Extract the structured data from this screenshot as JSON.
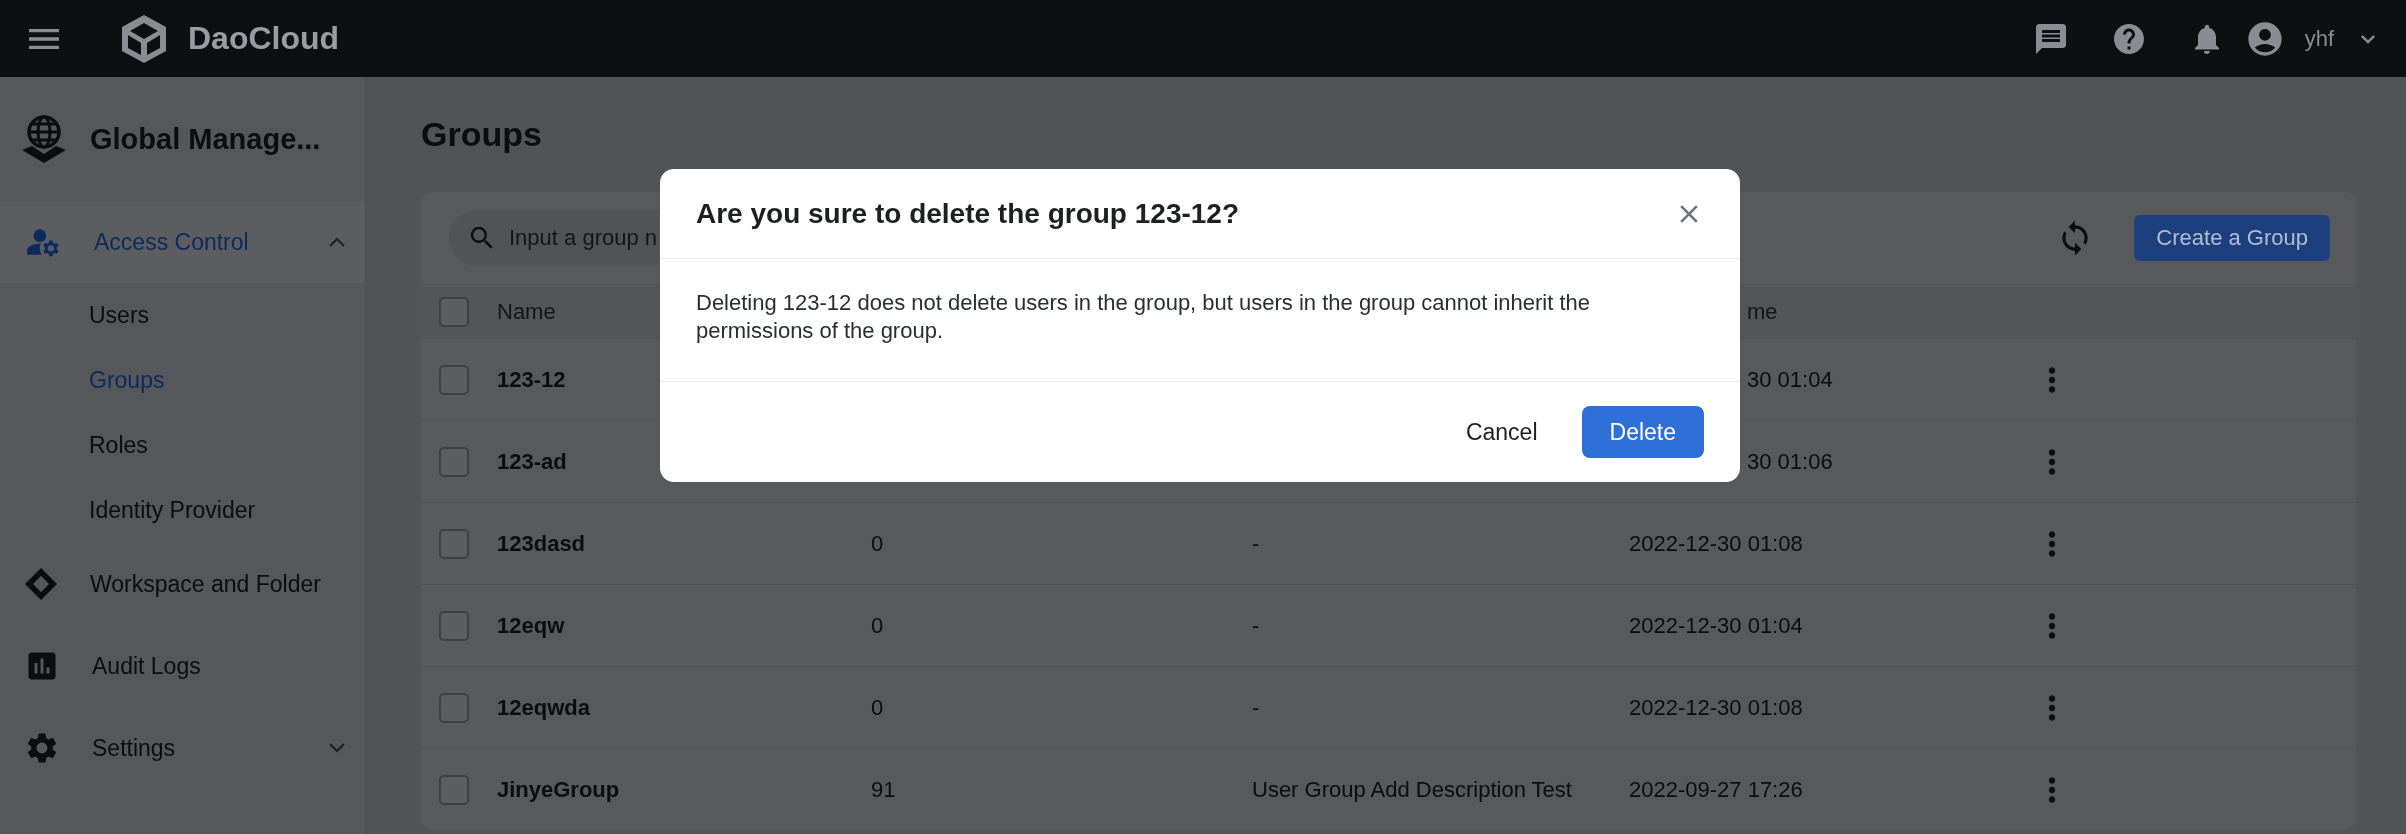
{
  "topbar": {
    "brand": "DaoCloud",
    "user": "yhf"
  },
  "sidebar": {
    "title": "Global Manage...",
    "items": [
      {
        "label": "Access Control",
        "kind": "section",
        "expanded": true,
        "selected": true,
        "children": [
          {
            "label": "Users",
            "selected": false
          },
          {
            "label": "Groups",
            "selected": true
          },
          {
            "label": "Roles",
            "selected": false
          },
          {
            "label": "Identity Provider",
            "selected": false
          }
        ]
      },
      {
        "label": "Workspace and Folder",
        "kind": "link",
        "selected": false
      },
      {
        "label": "Audit Logs",
        "kind": "link",
        "selected": false
      },
      {
        "label": "Settings",
        "kind": "section",
        "expanded": false,
        "selected": false
      }
    ]
  },
  "page": {
    "title": "Groups"
  },
  "toolbar": {
    "search": {
      "placeholder": "Input a group n"
    },
    "create_button": "Create a Group"
  },
  "table": {
    "columns": {
      "name": "Name",
      "column_4": "me"
    },
    "header_checked": false,
    "rows": [
      {
        "name": "123-12",
        "time": "30 01:04",
        "checked": false
      },
      {
        "name": "123-ad",
        "time": "30 01:06",
        "checked": false
      },
      {
        "name": "123dasd",
        "members": "0",
        "description": "-",
        "time": "2022-12-30 01:08",
        "checked": false
      },
      {
        "name": "12eqw",
        "members": "0",
        "description": "-",
        "time": "2022-12-30 01:04",
        "checked": false
      },
      {
        "name": "12eqwda",
        "members": "0",
        "description": "-",
        "time": "2022-12-30 01:08",
        "checked": false
      },
      {
        "name": "JinyeGroup",
        "members": "91",
        "description": "User Group Add Description Test",
        "time": "2022-09-27 17:26",
        "checked": false
      }
    ]
  },
  "dialog": {
    "title": "Are you sure to delete the group 123-12?",
    "message": "Deleting 123-12 does not delete users in the group, but users in the group cannot inherit the permissions of the group.",
    "buttons": {
      "cancel": "Cancel",
      "confirm": "Delete"
    }
  }
}
